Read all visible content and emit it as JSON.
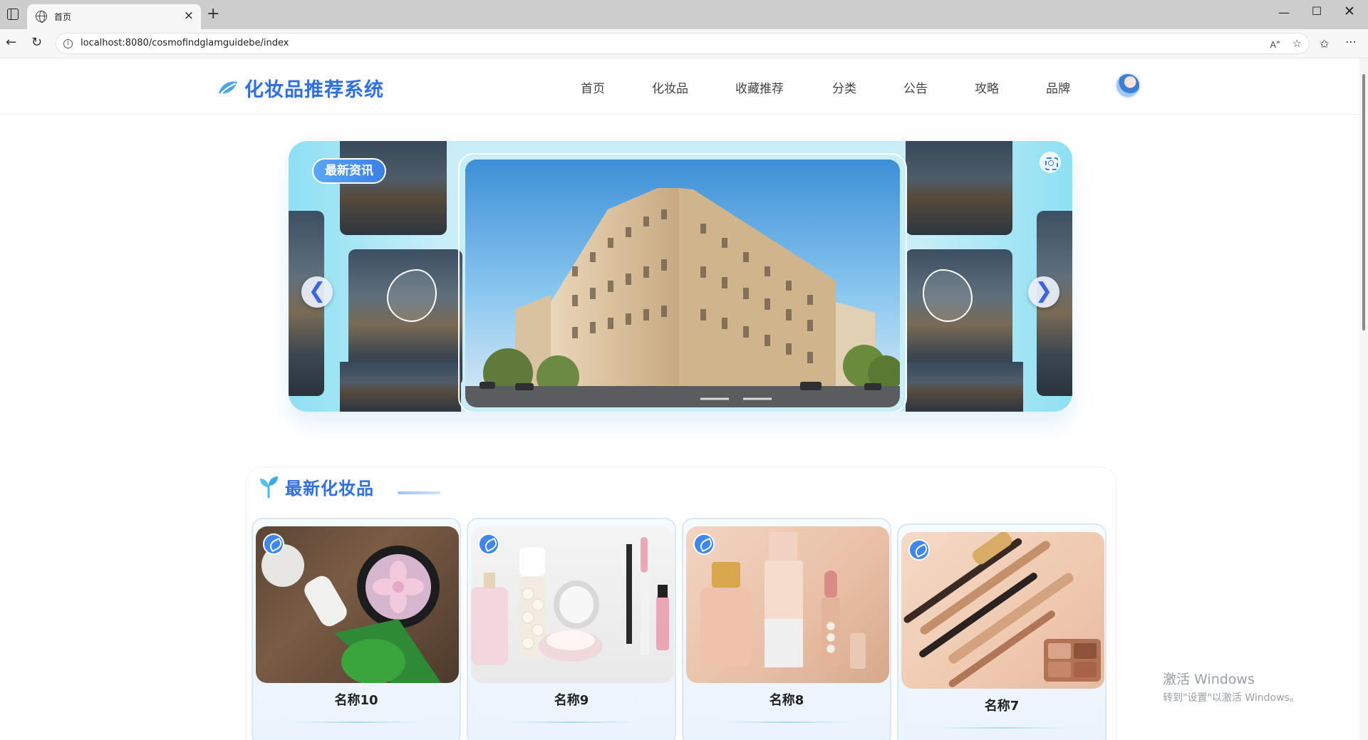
{
  "browser": {
    "tab_title": "首页",
    "url": "localhost:8080/cosmofindglamguidebe/index"
  },
  "site": {
    "brand_name": "化妆品推荐系统",
    "brand_color": "#2f6fe0",
    "nav": [
      "首页",
      "化妆品",
      "收藏推荐",
      "分类",
      "公告",
      "攻略",
      "品牌"
    ]
  },
  "carousel": {
    "badge": "最新资讯",
    "prev_arrow": "❮",
    "next_arrow": "❯"
  },
  "section": {
    "title": "最新化妆品",
    "cards": [
      {
        "name": "名称10",
        "image": "eyeshadow-and-serum-photo"
      },
      {
        "name": "名称9",
        "image": "perfume-pearls-compact-photo"
      },
      {
        "name": "名称8",
        "image": "perfume-foundation-lipstick-photo"
      },
      {
        "name": "名称7",
        "image": "makeup-brushes-palette-photo"
      }
    ]
  },
  "watermark": {
    "title": "激活 Windows",
    "subtitle": "转到\"设置\"以激活 Windows。"
  }
}
